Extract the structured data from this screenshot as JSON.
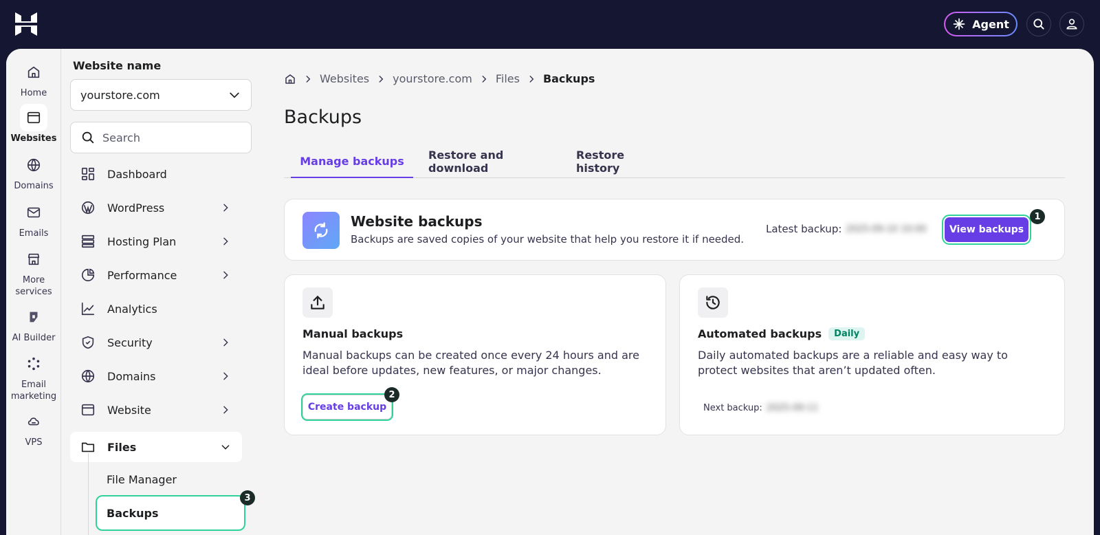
{
  "topbar": {
    "agent_label": "Agent"
  },
  "rail": {
    "items": [
      {
        "label": "Home"
      },
      {
        "label": "Websites"
      },
      {
        "label": "Domains"
      },
      {
        "label": "Emails"
      },
      {
        "label": "More services"
      },
      {
        "label": "AI Builder"
      },
      {
        "label": "Email marketing"
      },
      {
        "label": "VPS"
      }
    ]
  },
  "sidebar": {
    "website_label": "Website name",
    "website_value": "yourstore.com",
    "search_placeholder": "Search",
    "items": [
      {
        "label": "Dashboard"
      },
      {
        "label": "WordPress"
      },
      {
        "label": "Hosting Plan"
      },
      {
        "label": "Performance"
      },
      {
        "label": "Analytics"
      },
      {
        "label": "Security"
      },
      {
        "label": "Domains"
      },
      {
        "label": "Website"
      },
      {
        "label": "Files"
      }
    ],
    "sub_items": [
      {
        "label": "File Manager"
      },
      {
        "label": "Backups"
      }
    ]
  },
  "breadcrumb": {
    "items": [
      "Websites",
      "yourstore.com",
      "Files",
      "Backups"
    ]
  },
  "page": {
    "title": "Backups"
  },
  "tabs": [
    {
      "label": "Manage backups"
    },
    {
      "label": "Restore and download"
    },
    {
      "label": "Restore history"
    }
  ],
  "website_backups": {
    "title": "Website backups",
    "description": "Backups are saved copies of your website that help you restore it if needed.",
    "latest_label": "Latest backup:",
    "latest_value": "2025-09-10 10:00",
    "button_label": "View backups"
  },
  "manual_backups": {
    "title": "Manual backups",
    "description": "Manual backups can be created once every 24 hours and are ideal before updates, new features, or major changes.",
    "button_label": "Create backup"
  },
  "automated_backups": {
    "title": "Automated backups",
    "badge": "Daily",
    "description": "Daily automated backups are a reliable and easy way to protect websites that aren’t updated often.",
    "next_label": "Next backup:",
    "next_value": "2025-09-11"
  },
  "step_badges": [
    "1",
    "2",
    "3"
  ],
  "colors": {
    "accent": "#673de6",
    "highlight": "#2fd39a",
    "topbar": "#151632"
  }
}
